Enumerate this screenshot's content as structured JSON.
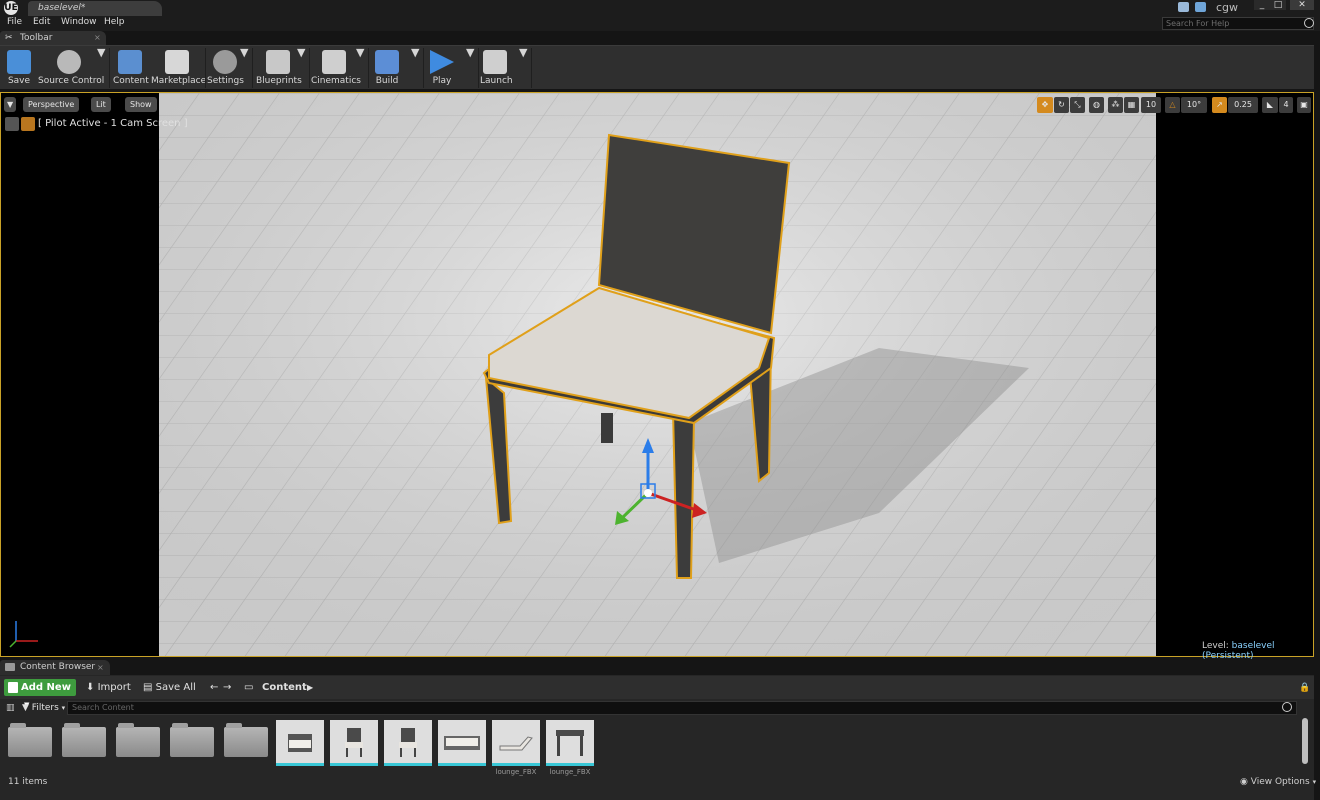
{
  "window": {
    "logo": "UE",
    "tab_title": "baselevel*",
    "user": "cgw",
    "controls": [
      "_",
      "□",
      "✕"
    ]
  },
  "menu": {
    "items": [
      "File",
      "Edit",
      "Window",
      "Help"
    ],
    "help_search_placeholder": "Search For Help"
  },
  "toolbar": {
    "tab_label": "Toolbar",
    "buttons": [
      {
        "label": "Save",
        "icon": "save-icon",
        "color": "#4a8fd8"
      },
      {
        "label": "Source Control",
        "icon": "source-control-icon",
        "color": "#b9b9b9"
      },
      {
        "label": "Content",
        "icon": "content-icon",
        "color": "#5b8fd0"
      },
      {
        "label": "Marketplace",
        "icon": "marketplace-icon",
        "color": "#d7d7d7"
      },
      {
        "label": "Settings",
        "icon": "settings-icon",
        "color": "#9a9a9a"
      },
      {
        "label": "Blueprints",
        "icon": "blueprints-icon",
        "color": "#c8c8c8"
      },
      {
        "label": "Cinematics",
        "icon": "cinematics-icon",
        "color": "#cfcfcf"
      },
      {
        "label": "Build",
        "icon": "build-icon",
        "color": "#5c8ed6"
      },
      {
        "label": "Play",
        "icon": "play-icon",
        "color": "#3f8be0"
      },
      {
        "label": "Launch",
        "icon": "launch-icon",
        "color": "#cfcfcf"
      }
    ]
  },
  "viewport": {
    "view_mode": "Perspective",
    "lit": "Lit",
    "show": "Show",
    "pilot_text": "[ Pilot Active - 1 Cam Screen ]",
    "grid_snap": "10",
    "rotation_snap": "10°",
    "scale_snap": "0.25",
    "camera_speed": "4",
    "level_label": "Level:",
    "level_value": "baselevel (Persistent)",
    "accent": "#c9a227"
  },
  "content_browser": {
    "tab_label": "Content Browser",
    "add_new": "Add New",
    "import": "Import",
    "save_all": "Save All",
    "path": "Content",
    "filters": "Filters",
    "search_placeholder": "Search Content",
    "assets": [
      "",
      "",
      "",
      "",
      "",
      ""
    ],
    "asset_labels": [
      "",
      "",
      "",
      "",
      "lounge_FBX",
      "lounge_FBX"
    ],
    "item_count": "11 items",
    "view_options": "View Options"
  }
}
